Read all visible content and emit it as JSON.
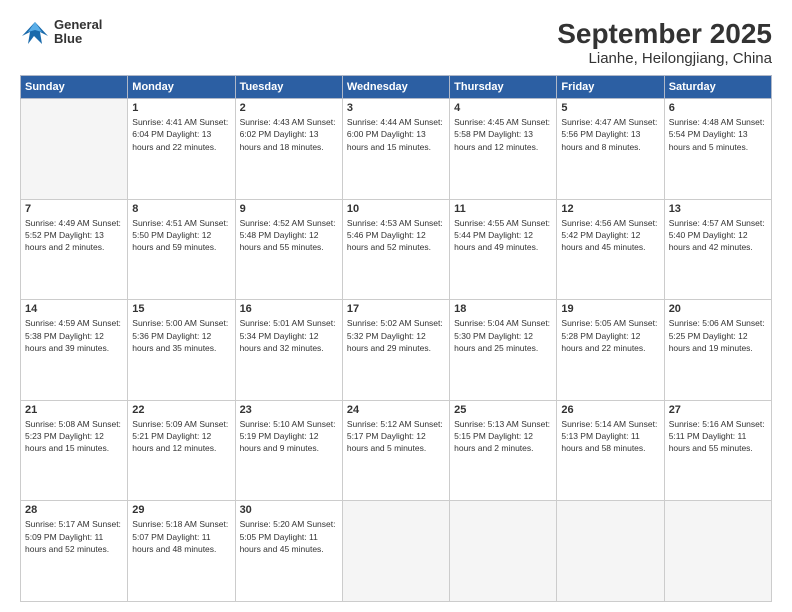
{
  "logo": {
    "line1": "General",
    "line2": "Blue"
  },
  "title": "September 2025",
  "subtitle": "Lianhe, Heilongjiang, China",
  "weekdays": [
    "Sunday",
    "Monday",
    "Tuesday",
    "Wednesday",
    "Thursday",
    "Friday",
    "Saturday"
  ],
  "weeks": [
    [
      {
        "day": "",
        "info": ""
      },
      {
        "day": "1",
        "info": "Sunrise: 4:41 AM\nSunset: 6:04 PM\nDaylight: 13 hours\nand 22 minutes."
      },
      {
        "day": "2",
        "info": "Sunrise: 4:43 AM\nSunset: 6:02 PM\nDaylight: 13 hours\nand 18 minutes."
      },
      {
        "day": "3",
        "info": "Sunrise: 4:44 AM\nSunset: 6:00 PM\nDaylight: 13 hours\nand 15 minutes."
      },
      {
        "day": "4",
        "info": "Sunrise: 4:45 AM\nSunset: 5:58 PM\nDaylight: 13 hours\nand 12 minutes."
      },
      {
        "day": "5",
        "info": "Sunrise: 4:47 AM\nSunset: 5:56 PM\nDaylight: 13 hours\nand 8 minutes."
      },
      {
        "day": "6",
        "info": "Sunrise: 4:48 AM\nSunset: 5:54 PM\nDaylight: 13 hours\nand 5 minutes."
      }
    ],
    [
      {
        "day": "7",
        "info": "Sunrise: 4:49 AM\nSunset: 5:52 PM\nDaylight: 13 hours\nand 2 minutes."
      },
      {
        "day": "8",
        "info": "Sunrise: 4:51 AM\nSunset: 5:50 PM\nDaylight: 12 hours\nand 59 minutes."
      },
      {
        "day": "9",
        "info": "Sunrise: 4:52 AM\nSunset: 5:48 PM\nDaylight: 12 hours\nand 55 minutes."
      },
      {
        "day": "10",
        "info": "Sunrise: 4:53 AM\nSunset: 5:46 PM\nDaylight: 12 hours\nand 52 minutes."
      },
      {
        "day": "11",
        "info": "Sunrise: 4:55 AM\nSunset: 5:44 PM\nDaylight: 12 hours\nand 49 minutes."
      },
      {
        "day": "12",
        "info": "Sunrise: 4:56 AM\nSunset: 5:42 PM\nDaylight: 12 hours\nand 45 minutes."
      },
      {
        "day": "13",
        "info": "Sunrise: 4:57 AM\nSunset: 5:40 PM\nDaylight: 12 hours\nand 42 minutes."
      }
    ],
    [
      {
        "day": "14",
        "info": "Sunrise: 4:59 AM\nSunset: 5:38 PM\nDaylight: 12 hours\nand 39 minutes."
      },
      {
        "day": "15",
        "info": "Sunrise: 5:00 AM\nSunset: 5:36 PM\nDaylight: 12 hours\nand 35 minutes."
      },
      {
        "day": "16",
        "info": "Sunrise: 5:01 AM\nSunset: 5:34 PM\nDaylight: 12 hours\nand 32 minutes."
      },
      {
        "day": "17",
        "info": "Sunrise: 5:02 AM\nSunset: 5:32 PM\nDaylight: 12 hours\nand 29 minutes."
      },
      {
        "day": "18",
        "info": "Sunrise: 5:04 AM\nSunset: 5:30 PM\nDaylight: 12 hours\nand 25 minutes."
      },
      {
        "day": "19",
        "info": "Sunrise: 5:05 AM\nSunset: 5:28 PM\nDaylight: 12 hours\nand 22 minutes."
      },
      {
        "day": "20",
        "info": "Sunrise: 5:06 AM\nSunset: 5:25 PM\nDaylight: 12 hours\nand 19 minutes."
      }
    ],
    [
      {
        "day": "21",
        "info": "Sunrise: 5:08 AM\nSunset: 5:23 PM\nDaylight: 12 hours\nand 15 minutes."
      },
      {
        "day": "22",
        "info": "Sunrise: 5:09 AM\nSunset: 5:21 PM\nDaylight: 12 hours\nand 12 minutes."
      },
      {
        "day": "23",
        "info": "Sunrise: 5:10 AM\nSunset: 5:19 PM\nDaylight: 12 hours\nand 9 minutes."
      },
      {
        "day": "24",
        "info": "Sunrise: 5:12 AM\nSunset: 5:17 PM\nDaylight: 12 hours\nand 5 minutes."
      },
      {
        "day": "25",
        "info": "Sunrise: 5:13 AM\nSunset: 5:15 PM\nDaylight: 12 hours\nand 2 minutes."
      },
      {
        "day": "26",
        "info": "Sunrise: 5:14 AM\nSunset: 5:13 PM\nDaylight: 11 hours\nand 58 minutes."
      },
      {
        "day": "27",
        "info": "Sunrise: 5:16 AM\nSunset: 5:11 PM\nDaylight: 11 hours\nand 55 minutes."
      }
    ],
    [
      {
        "day": "28",
        "info": "Sunrise: 5:17 AM\nSunset: 5:09 PM\nDaylight: 11 hours\nand 52 minutes."
      },
      {
        "day": "29",
        "info": "Sunrise: 5:18 AM\nSunset: 5:07 PM\nDaylight: 11 hours\nand 48 minutes."
      },
      {
        "day": "30",
        "info": "Sunrise: 5:20 AM\nSunset: 5:05 PM\nDaylight: 11 hours\nand 45 minutes."
      },
      {
        "day": "",
        "info": ""
      },
      {
        "day": "",
        "info": ""
      },
      {
        "day": "",
        "info": ""
      },
      {
        "day": "",
        "info": ""
      }
    ]
  ]
}
